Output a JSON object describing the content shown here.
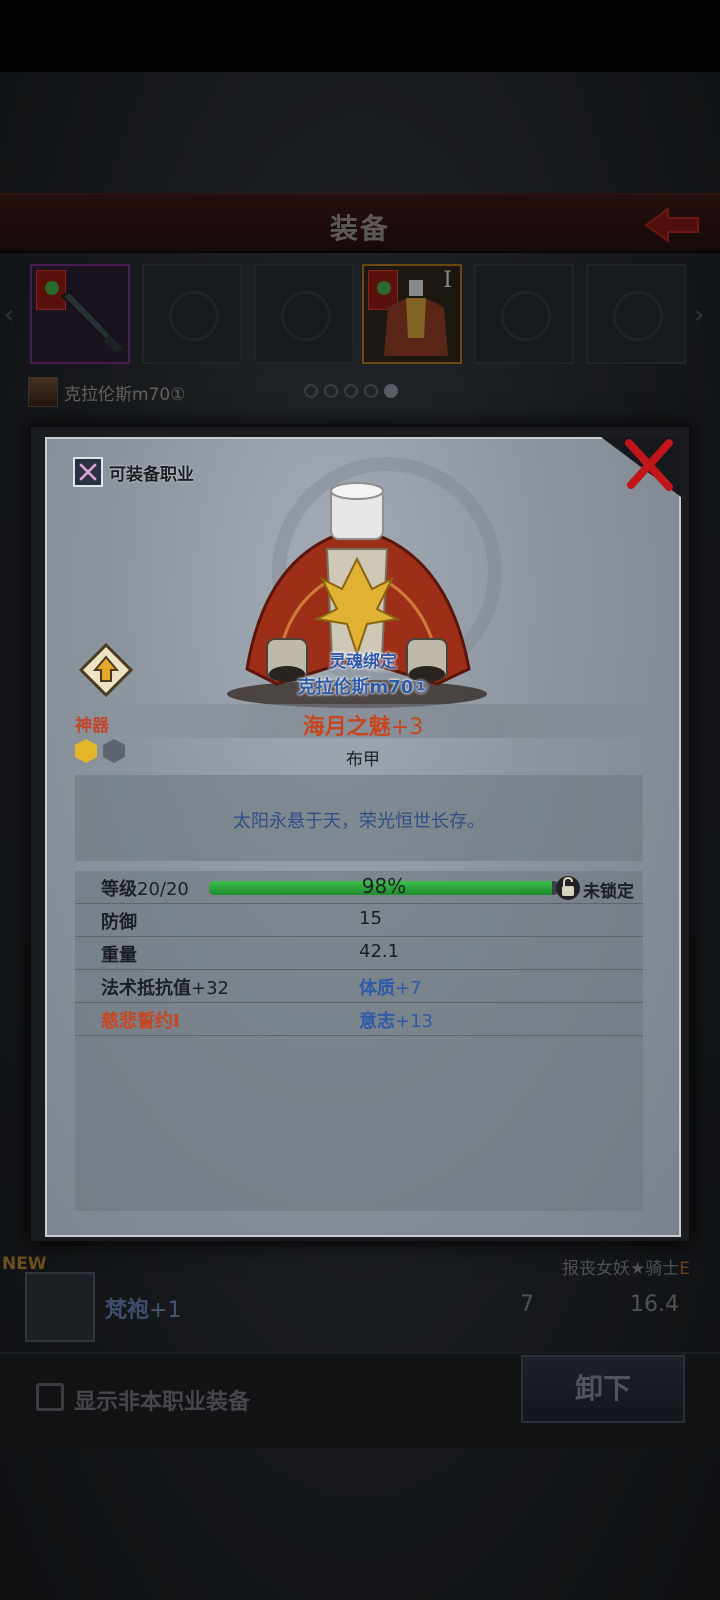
{
  "header": {
    "title": "装备"
  },
  "owner": {
    "name": "克拉伦斯m70①"
  },
  "list": {
    "new_label": "NEW",
    "rows": [
      {
        "name": "梵袍",
        "plus": "+1",
        "value1": "7",
        "value2": "16.4",
        "class_text": "报丧女妖★骑士",
        "class_mark": "E"
      }
    ]
  },
  "bottom": {
    "checkbox_label": "显示非本职业装备",
    "unequip_label": "卸下"
  },
  "detail": {
    "job_label": "可装备职业",
    "bind_label": "灵魂绑定",
    "bound_to": "克拉伦斯m70①",
    "artifact_label": "神器",
    "item_name": "海月之魅",
    "item_plus": "+3",
    "item_type": "布甲",
    "description": "太阳永悬于天，荣光恒世长存。",
    "level": {
      "label": "等级",
      "value": "20/20",
      "percent_text": "98%",
      "fraction": 0.98
    },
    "lock_label": "未锁定",
    "stats": [
      {
        "label": "防御",
        "value": "15"
      },
      {
        "label": "重量",
        "value": "42.1"
      }
    ],
    "bonuses": {
      "spell_resist_label": "法术抵抗值",
      "spell_resist_value": "+32",
      "con_label": "体质",
      "con_value": "+7",
      "vow_label": "慈悲誓约I",
      "will_label": "意志",
      "will_value": "+13"
    }
  }
}
